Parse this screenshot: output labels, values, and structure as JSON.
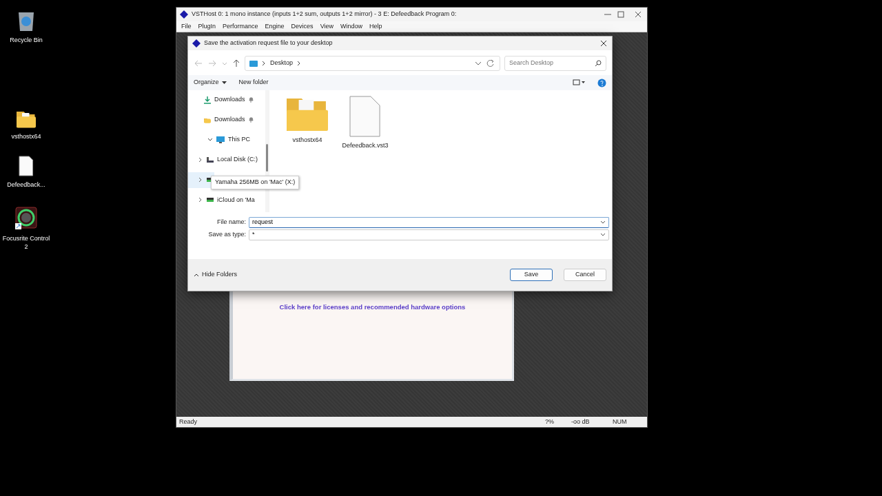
{
  "desktop_icons": [
    {
      "label": "Recycle Bin",
      "kind": "recycle"
    },
    {
      "label": "vsthostx64",
      "kind": "folder"
    },
    {
      "label": "Defeedback...",
      "kind": "file"
    },
    {
      "label": "Focusrite Control 2",
      "kind": "app"
    }
  ],
  "main_window": {
    "title": "VSTHost 0: 1 mono instance (inputs 1+2 sum, outputs 1+2 mirror) - 3 E: Defeedback Program 0:",
    "menu": [
      "File",
      "PlugIn",
      "Performance",
      "Engine",
      "Devices",
      "View",
      "Window",
      "Help"
    ],
    "link": "Click here for licenses and recommended hardware options",
    "status_bar": [
      "Ready",
      "?%",
      "-oo dB",
      "NUM"
    ]
  },
  "dialog": {
    "title": "Save the activation request file to your desktop",
    "address": "Desktop",
    "search": {
      "placeholder": "Search Desktop"
    },
    "toolbar": [
      "Organize",
      "New folder"
    ],
    "nav": [
      {
        "label": "Downloads",
        "kind": "download",
        "pinned": true
      },
      {
        "label": "Downloads",
        "kind": "folder",
        "pinned": true
      },
      {
        "label": "This PC",
        "kind": "pc",
        "expanded": true,
        "children": [
          {
            "label": "Local Disk (C:)",
            "kind": "disk",
            "expanded": false,
            "hovered": false
          },
          {
            "kind": "drive",
            "expanded": false,
            "hovered": true
          },
          {
            "label": "iCloud on 'Ma",
            "kind": "drive",
            "expanded": false,
            "hovered": false
          }
        ]
      }
    ],
    "files": [
      {
        "label": "vsthostx64",
        "kind": "folder"
      },
      {
        "label": "Defeedback.vst3",
        "kind": "file"
      }
    ],
    "file_name_label": "File name:",
    "file_name": "request",
    "type_label": "Save as type:",
    "save_as_type": "*",
    "hide_folders": "Hide Folders",
    "buttons": [
      {
        "label": "Save",
        "default": true
      },
      {
        "label": "Cancel",
        "default": false
      }
    ],
    "tooltip": "Yamaha 256MB on 'Mac' (X:)"
  }
}
